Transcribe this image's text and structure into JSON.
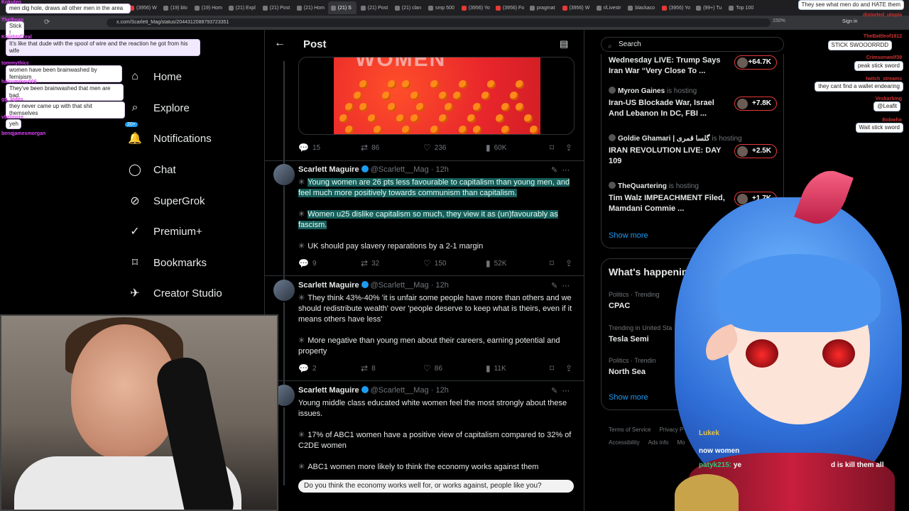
{
  "browser": {
    "tabs": [
      {
        "label": "(3956) W",
        "icon": "youtube"
      },
      {
        "label": "(19) blo",
        "icon": "x"
      },
      {
        "label": "(19) Hom",
        "icon": "x"
      },
      {
        "label": "(21) Expl",
        "icon": "x"
      },
      {
        "label": "(21) Post",
        "icon": "x"
      },
      {
        "label": "(21) Hom",
        "icon": "x"
      },
      {
        "label": "(21) S",
        "icon": "x",
        "active": true
      },
      {
        "label": "(21) Post",
        "icon": "x"
      },
      {
        "label": "(21) clan",
        "icon": "x"
      },
      {
        "label": "smp 500",
        "icon": "x"
      },
      {
        "label": "(3956) Yo",
        "icon": "youtube"
      },
      {
        "label": "(3956) Fo",
        "icon": "youtube"
      },
      {
        "label": "pragmat",
        "icon": "x"
      },
      {
        "label": "(3956) W",
        "icon": "youtube"
      },
      {
        "label": "r/Livestr",
        "icon": "reddit"
      },
      {
        "label": "blackaco",
        "icon": "x"
      },
      {
        "label": "(3956) Yo",
        "icon": "youtube"
      },
      {
        "label": "(99+) Tu",
        "icon": "x"
      },
      {
        "label": "Top 100",
        "icon": "x"
      }
    ],
    "url": "x.com/Scarlett_Mag/status/2044312088793723351",
    "zoom": "150%",
    "signin": "Sign in"
  },
  "nav": {
    "items": [
      {
        "label": "Home",
        "icon": "home-icon",
        "glyph": "⌂"
      },
      {
        "label": "Explore",
        "icon": "search-icon",
        "glyph": "⌕"
      },
      {
        "label": "Notifications",
        "icon": "bell-icon",
        "glyph": "🔔",
        "badge": "20+"
      },
      {
        "label": "Chat",
        "icon": "chat-icon",
        "glyph": "◯"
      },
      {
        "label": "SuperGrok",
        "icon": "grok-icon",
        "glyph": "⊘"
      },
      {
        "label": "Premium+",
        "icon": "verified-icon",
        "glyph": "✓"
      },
      {
        "label": "Bookmarks",
        "icon": "bookmark-icon",
        "glyph": "⌑"
      },
      {
        "label": "Creator Studio",
        "icon": "rocket-icon",
        "glyph": "✈"
      }
    ]
  },
  "post_header": {
    "title": "Post",
    "back": "←",
    "reader": "▤"
  },
  "media_tweet": {
    "overlay_word": "WOMEN",
    "actions": {
      "replies": "15",
      "reposts": "86",
      "likes": "236",
      "views": "60K"
    }
  },
  "tweets": [
    {
      "name": "Scarlett Maguire",
      "handle": "@Scarlett__Mag",
      "time": "· 12h",
      "lines": [
        {
          "text": "Young women are 26 pts less favourable to capitalism than young men, and feel much more positively towards communism than capitalism.",
          "highlight": true
        },
        {
          "text": "Women u25 dislike capitalism so much, they view it as (un)favourably as fascism.",
          "highlight": true
        },
        {
          "text": "UK should pay slavery reparations by a 2-1 margin",
          "highlight": false
        }
      ],
      "actions": {
        "replies": "9",
        "reposts": "32",
        "likes": "150",
        "views": "52K"
      }
    },
    {
      "name": "Scarlett Maguire",
      "handle": "@Scarlett__Mag",
      "time": "· 12h",
      "lines": [
        {
          "text": "They think 43%-40% 'it is unfair some people have more than others and we should redistribute wealth' over 'people deserve to keep what is theirs, even if it means others have less'",
          "highlight": false
        },
        {
          "text": "More negative than young men about their careers, earning potential and property",
          "highlight": false
        }
      ],
      "actions": {
        "replies": "2",
        "reposts": "8",
        "likes": "86",
        "views": "11K"
      }
    },
    {
      "name": "Scarlett Maguire",
      "handle": "@Scarlett__Mag",
      "time": "· 12h",
      "lines": [
        {
          "text": "Young middle class educated white women feel the most strongly about these issues.",
          "bullet": false
        },
        {
          "text": "17% of ABC1 women have a positive view of capitalism compared to 32% of C2DE women",
          "bullet": true
        },
        {
          "text": "ABC1 women more likely to think the economy works against them",
          "bullet": true
        }
      ],
      "poll": "Do you think the economy works well for, or works against, people like you?"
    }
  ],
  "sidebar": {
    "search_placeholder": "Search",
    "live": [
      {
        "host": "",
        "title": "Wednesday LIVE: Trump Says Iran War “Very Close To ...",
        "count": "+64.7K"
      },
      {
        "host": "Myron Gaines",
        "hosting": "is hosting",
        "title": "Iran-US Blockade War, Israel And Lebanon In DC, FBI ...",
        "count": "+7.8K"
      },
      {
        "host": "Goldie Ghamari | گلسا قمری",
        "hosting": "is hosting",
        "title": "IRAN REVOLUTION LIVE: DAY 109",
        "count": "+2.5K"
      },
      {
        "host": "TheQuartering",
        "hosting": "is hosting",
        "title": "Tim Walz IMPEACHMENT Filed, Mamdani Commie ...",
        "count": "+1.7K"
      }
    ],
    "show_more": "Show more",
    "trends_title": "What's happening",
    "trends": [
      {
        "category": "Politics · Trending",
        "name": "CPAC"
      },
      {
        "category": "Trending in United Sta",
        "name": "Tesla Semi"
      },
      {
        "category": "Politics · Trendin",
        "name": "North Sea"
      }
    ],
    "footer": [
      "Terms of Service",
      "Privacy P",
      "Accessibility",
      "Ads info",
      "Mo"
    ]
  },
  "chat_left": [
    {
      "user": "Kokuten",
      "msg": "men dig hole, draws all other men in the area"
    },
    {
      "user": "Thelfman",
      "msg": "Stick !"
    },
    {
      "user": "KnightofZeal",
      "msg": "It's like that dude with the spool of wire and the reaction he got from his wife"
    },
    {
      "user": "tommythicc",
      "msg": "women have been brainwashed by femisism"
    },
    {
      "user": "halcumikey006",
      "msg": "They've been brainwashed that men are bad."
    },
    {
      "user": "gg_bytes",
      "msg": "they never came up with that shit themselves"
    },
    {
      "user": "vbelmore",
      "msg": "yeh"
    },
    {
      "user": "benqjamesmorgan",
      "msg": ""
    }
  ],
  "chat_right": [
    {
      "user": "",
      "msg": "They see what men do and HATE them"
    },
    {
      "user": "distorted_utopia",
      "msg": ""
    },
    {
      "user": "TheBattleof1812",
      "msg": "STICK SWOOORRDD"
    },
    {
      "user": "Crimsonwolf39",
      "msg": "peak stick sword"
    },
    {
      "user": "twitch_streams",
      "msg": "they cant find a wallet endearing"
    },
    {
      "user": "Veskarbing",
      "msg": "@Leafit"
    },
    {
      "user": "Bobwho",
      "msg": "Wait stick sword"
    }
  ],
  "overlay_chat": [
    {
      "user": "Lukek",
      "msg": "now women"
    },
    {
      "user": "patyk215:",
      "msg": "ye"
    },
    {
      "user": "",
      "msg": "d is kill them all"
    }
  ],
  "colors": {
    "accent": "#1d9bf0",
    "highlight": "#165e5a",
    "live_border": "#e53a3a"
  }
}
